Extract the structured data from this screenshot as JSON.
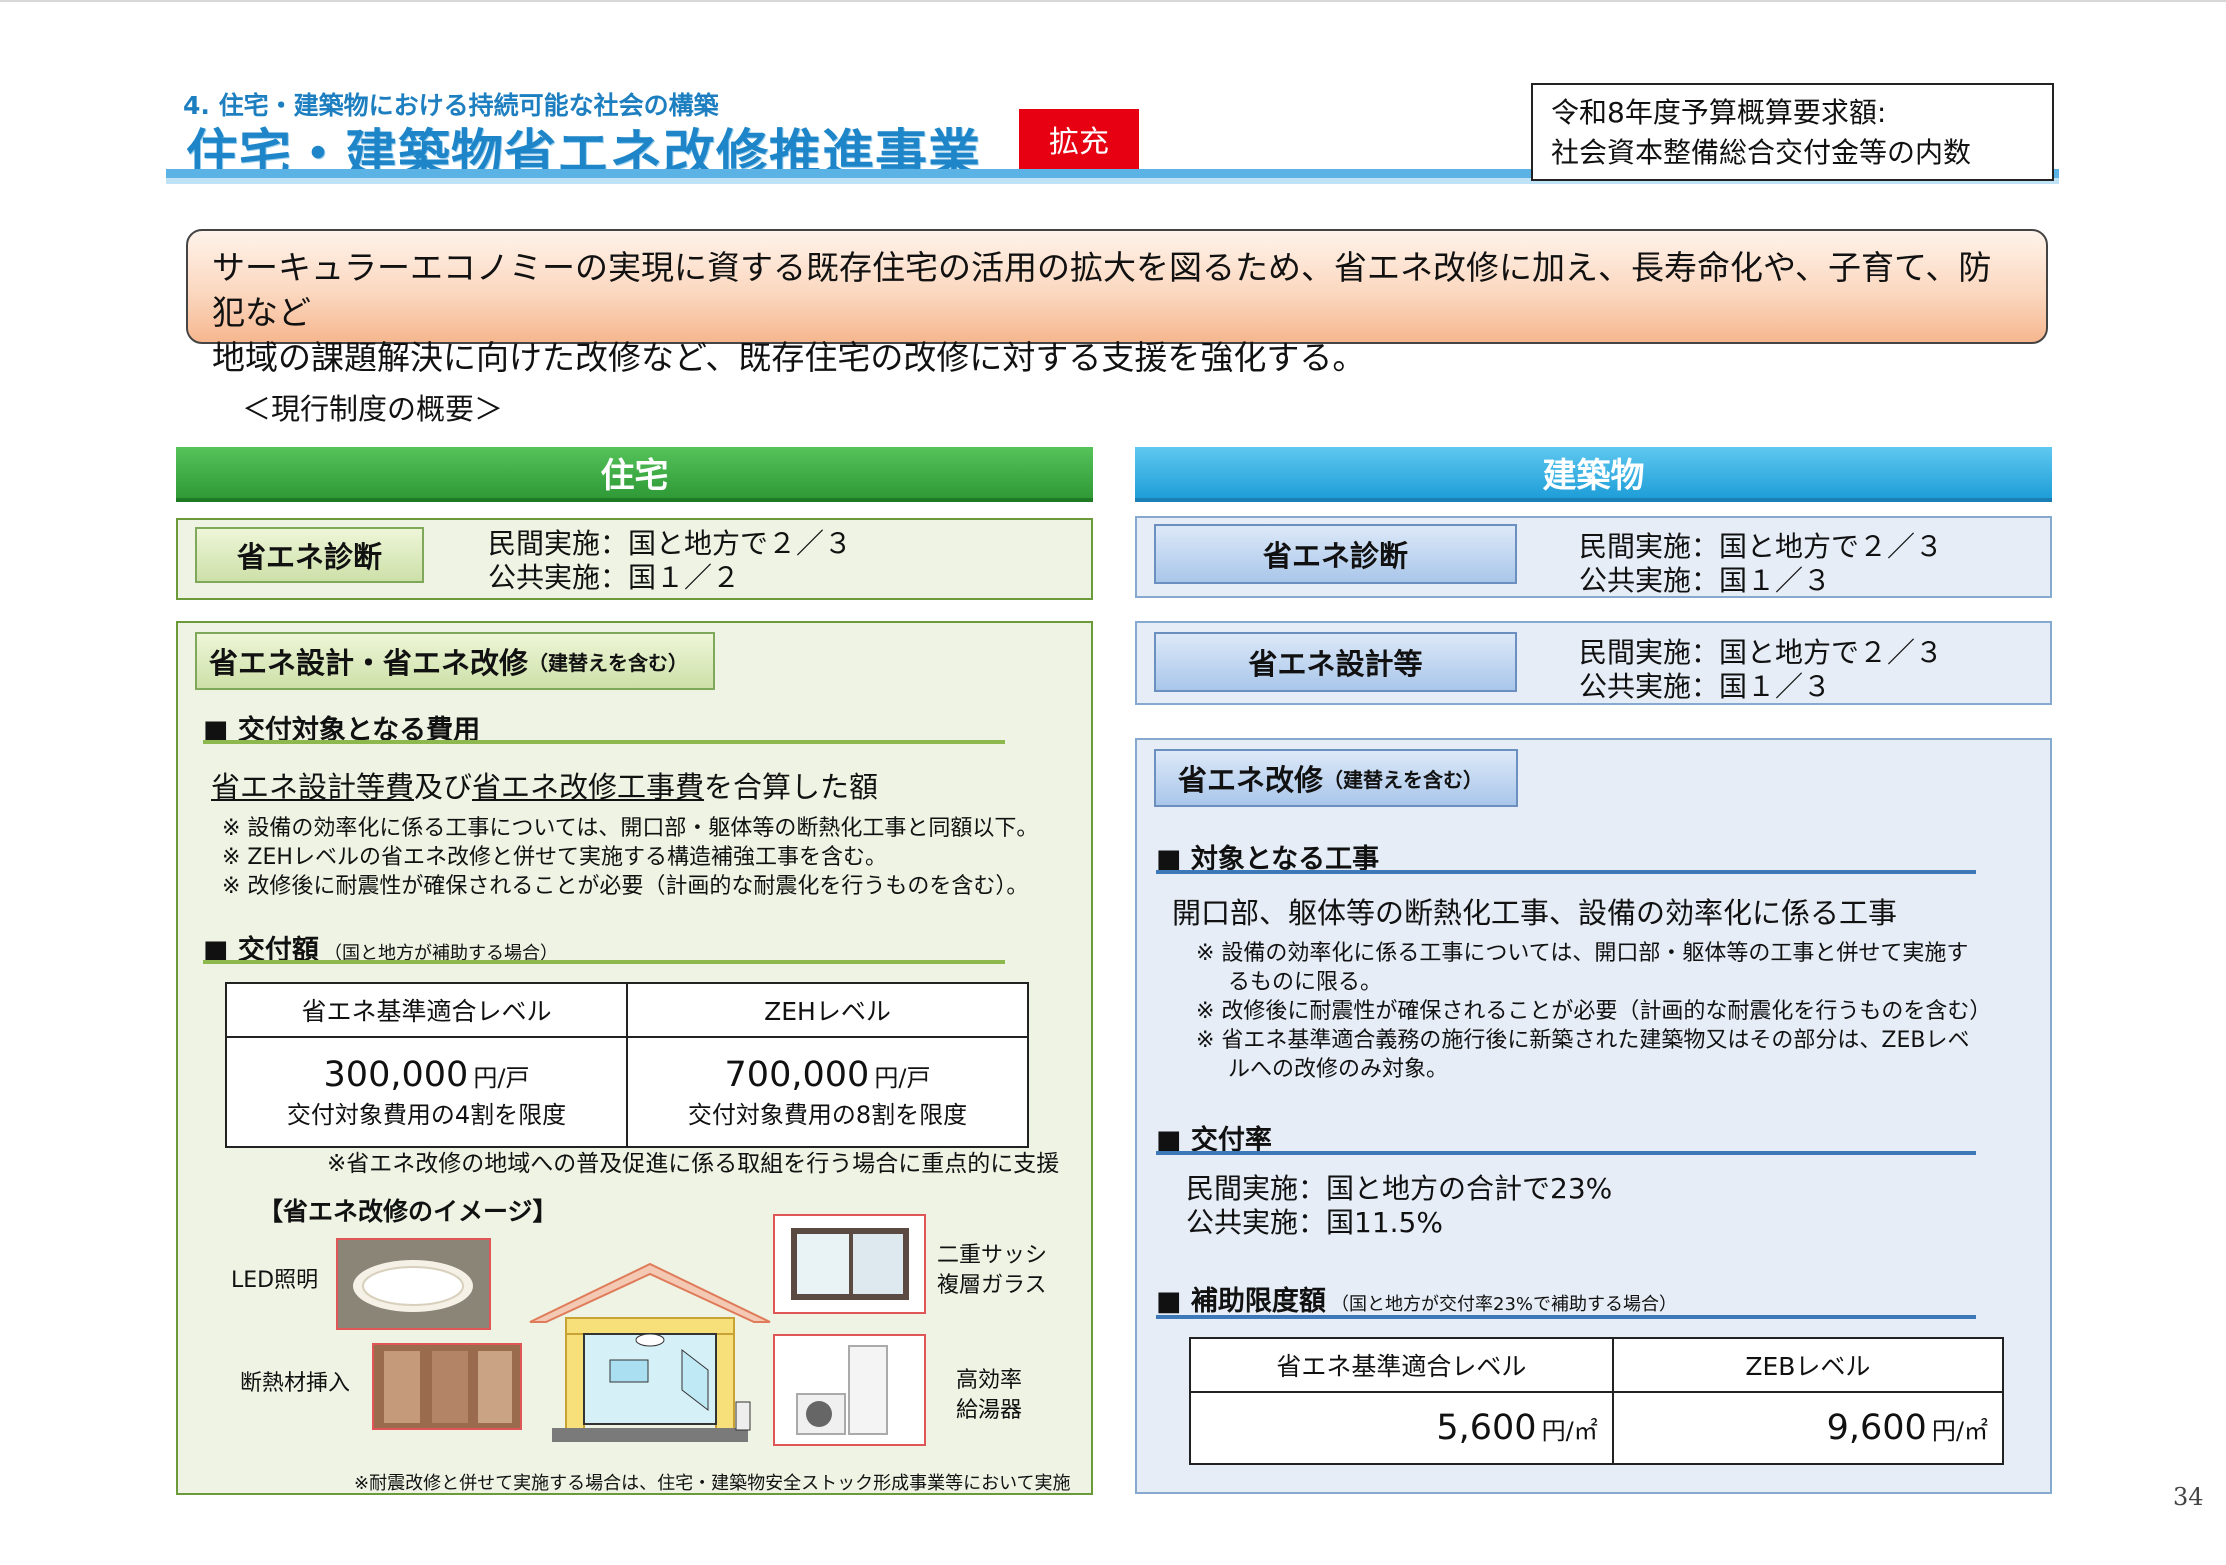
{
  "header": {
    "section_label": "4. 住宅・建築物における持続可能な社会の構築",
    "title": "住宅・建築物省エネ改修推進事業",
    "tag": "拡充",
    "budget_line1": "令和8年度予算概算要求額:",
    "budget_line2": "社会資本整備総合交付金等の内数"
  },
  "summary": {
    "line1": "サーキュラーエコノミーの実現に資する既存住宅の活用の拡大を図るため、省エネ改修に加え、長寿命化や、子育て、防犯など",
    "line2": "地域の課題解決に向けた改修など、既存住宅の改修に対する支援を強化する。"
  },
  "overview_label": "＜現行制度の概要＞",
  "housing": {
    "header": "住宅",
    "diag_label": "省エネ診断",
    "diag_private": "民間実施：国と地方で２／３",
    "diag_public": "公共実施：国１／２",
    "design_label_main": "省エネ設計・省エネ改修",
    "design_label_sub": "（建替えを含む）",
    "cost_heading": "■ 交付対象となる費用",
    "cost_text_a": "省エネ設計等費",
    "cost_text_b": "及び",
    "cost_text_c": "省エネ改修工事費",
    "cost_text_d": "を合算した額",
    "notes": [
      "※ 設備の効率化に係る工事については、開口部・躯体等の断熱化工事と同額以下。",
      "※ ZEHレベルの省エネ改修と併せて実施する構造補強工事を含む。",
      "※ 改修後に耐震性が確保されることが必要（計画的な耐震化を行うものを含む）。"
    ],
    "amount_heading": "■ 交付額",
    "amount_heading_sub": "（国と地方が補助する場合）",
    "table_col1": "省エネ基準適合レベル",
    "table_col2": "ZEHレベル",
    "value1": "300,000",
    "value2": "700,000",
    "unit": "円/戸",
    "limit1": "交付対象費用の4割を限度",
    "limit2": "交付対象費用の8割を限度",
    "focus_note": "※省エネ改修の地域への普及促進に係る取組を行う場合に重点的に支援",
    "image_title": "【省エネ改修のイメージ】",
    "img_led": "LED照明",
    "img_insul": "断熱材挿入",
    "img_sash1": "二重サッシ",
    "img_sash2": "複層ガラス",
    "img_heater1": "高効率",
    "img_heater2": "給湯器",
    "bottom_note": "※耐震改修と併せて実施する場合は、住宅・建築物安全ストック形成事業等において実施"
  },
  "building": {
    "header": "建築物",
    "diag_label": "省エネ診断",
    "diag_private": "民間実施：国と地方で２／３",
    "diag_public": "公共実施：国１／３",
    "design_label": "省エネ設計等",
    "design_private": "民間実施：国と地方で２／３",
    "design_public": "公共実施：国１／３",
    "retrofit_label_main": "省エネ改修",
    "retrofit_label_sub": "（建替えを含む）",
    "target_heading": "■ 対象となる工事",
    "target_text": "開口部、躯体等の断熱化工事、設備の効率化に係る工事",
    "notes": [
      "※ 設備の効率化に係る工事については、開口部・躯体等の工事と併せて実施す",
      "るものに限る。",
      "※ 改修後に耐震性が確保されることが必要（計画的な耐震化を行うものを含む）",
      "※ 省エネ基準適合義務の施行後に新築された建築物又はその部分は、ZEBレベ",
      "ルへの改修のみ対象。"
    ],
    "rate_heading": "■ 交付率",
    "rate_private": "民間実施：国と地方の合計で23%",
    "rate_public": "公共実施：国11.5%",
    "limit_heading": "■ 補助限度額",
    "limit_heading_sub": "（国と地方が交付率23%で補助する場合）",
    "table_col1": "省エネ基準適合レベル",
    "table_col2": "ZEBレベル",
    "value1": "5,600",
    "value2": "9,600",
    "unit": "円/㎡"
  },
  "page_number": "34",
  "colors": {
    "accent_blue": "#1e86c8",
    "accent_green": "#2f9a36",
    "tag_red": "#e60012"
  }
}
